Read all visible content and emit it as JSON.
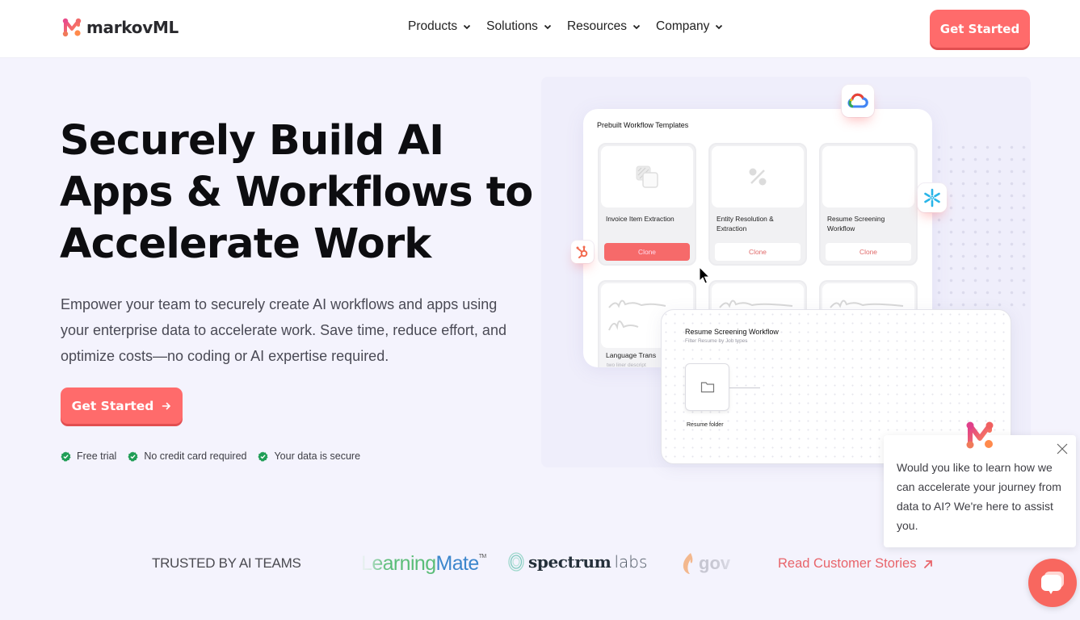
{
  "header": {
    "brand": "markovML",
    "nav": [
      {
        "label": "Products"
      },
      {
        "label": "Solutions"
      },
      {
        "label": "Resources"
      },
      {
        "label": "Company"
      }
    ],
    "cta_label": "Get Started"
  },
  "hero": {
    "title_lines": [
      "Securely Build AI",
      "Apps & Workflows to",
      "Accelerate Work"
    ],
    "subtitle": "Empower your team to securely create AI workflows and apps using your enterprise data to accelerate work. Save time, reduce effort, and optimize costs—no coding or AI expertise required.",
    "cta_label": "Get Started",
    "perks": [
      "Free trial",
      "No credit card required",
      "Your data is secure"
    ]
  },
  "illustration": {
    "templates_title": "Prebuilt Workflow Templates",
    "templates": [
      {
        "name": "Invoice Item Extraction",
        "button": "Clone",
        "active": true
      },
      {
        "name": "Entity Resolution & Extraction",
        "button": "Clone",
        "active": false
      },
      {
        "name": "Resume Screening Workflow",
        "button": "Clone",
        "active": false
      }
    ],
    "second_row": [
      {
        "name": "Language Trans",
        "desc": "two liner descript"
      }
    ],
    "workflow": {
      "title": "Resume Screening Workflow",
      "subtitle": "Filter Resume by Job types",
      "node_label": "Resume folder"
    },
    "integrations": [
      "google-cloud",
      "snowflake",
      "hubspot"
    ]
  },
  "trusted": {
    "label": "TRUSTED BY AI TEAMS",
    "logos": {
      "learningmate": [
        "L",
        "earning",
        "Mate"
      ],
      "learningmate_tm": "TM",
      "spectrum": [
        "spectrum",
        "labs"
      ],
      "gov": "gov"
    },
    "link_label": "Read Customer Stories"
  },
  "chat": {
    "message": "Would you like to learn how we can accelerate your journey from data to AI? We're here to assist you."
  },
  "colors": {
    "accent": "#ff6b6b",
    "background": "#f4f3fd",
    "check_green": "#1f9d55"
  }
}
